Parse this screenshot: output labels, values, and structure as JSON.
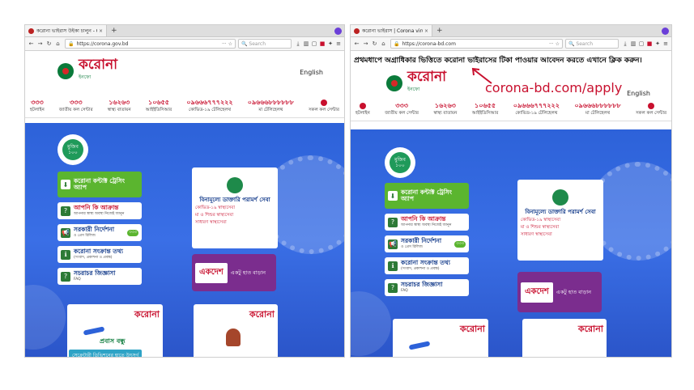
{
  "left": {
    "tab_title": "করোনা ভাইরাস উইকা চালুন - Co",
    "url": "https://corona.gov.bd",
    "search_placeholder": "Search",
    "logo_text": "করোনা",
    "logo_sub": "ইনফো",
    "english_label": "English",
    "hotlines": [
      {
        "number": "৩৩৩",
        "label": "হটলাইন"
      },
      {
        "number": "৩৩৩",
        "label": "জাতীয় কল সেন্টার"
      },
      {
        "number": "১৬২৬৩",
        "label": "স্বাস্থ্য বাতায়ন"
      },
      {
        "number": "১০৬৫৫",
        "label": "আইইডিসিআর"
      },
      {
        "number": "০৯৬৬৬৭৭৭২২২",
        "label": "কোভিড-১৯ টেলিহেলথ"
      },
      {
        "number": "০৯৬৬৬৮৮৮৮৮৮",
        "label": "মা টেলিহেলথ"
      },
      {
        "number": "",
        "label": "সকল কল সেন্টার"
      }
    ],
    "menu": [
      {
        "title": "করোনা কন্টাক্ট ট্রেসিং অ্যাপ",
        "sub": ""
      },
      {
        "title": "আপনি কি আক্রান্ত",
        "sub": "আপনার স্বাস্থ্য অবস্থা নিজেই জানুন"
      },
      {
        "title": "সরকারী নির্দেশনা",
        "sub": "ও প্রেস রিলিজ",
        "pill": "৩৩৩"
      },
      {
        "title": "করোনা সংক্রান্ত তথ্য",
        "sub": "(সংবাদ, প্রকাশনা ও প্রবন্ধ)"
      },
      {
        "title": "সচরাচর জিজ্ঞাসা",
        "sub": "FAQ"
      }
    ],
    "card": {
      "title": "বিনামূল্যে ডাক্তারি পরামর্শ সেবা",
      "items": [
        "কোভিড-১৯ স্বাস্থ্যসেবা",
        "মা ও শিশুর স্বাস্থ্যসেবা",
        "সাধারণ স্বাস্থ্যসেবা"
      ]
    },
    "ekdesh": {
      "box": "একদেশ",
      "text": "একটু হাত বাড়ান"
    },
    "promo1": {
      "logo": "করোনা",
      "text": "প্রবাস বন্ধু",
      "banner": "সেক্রেটারী ডিভিশনের হাতে উৎসর্গ"
    },
    "promo2": {
      "logo": "করোনা"
    }
  },
  "right": {
    "tab_title": "করোনা ভাইরাস | Corona virus",
    "url": "https://corona-bd.com",
    "search_placeholder": "Search",
    "notice": "প্রথমধাপে অগ্রাধিকার ভিত্তিতে করোনা ভাইরাসের টিকা পাওয়ার আবেদন করতে এখানে ক্লিক করুন।",
    "scam_url": "corona-bd.com/apply",
    "logo_text": "করোনা",
    "logo_sub": "ইনফো",
    "english_label": "English",
    "hotlines": [
      {
        "number": "",
        "label": "হটলাইন"
      },
      {
        "number": "৩৩৩",
        "label": "জাতীয় কল সেন্টার"
      },
      {
        "number": "১৬২৬৩",
        "label": "স্বাস্থ্য বাতায়ন"
      },
      {
        "number": "১০৬৫৫",
        "label": "আইইডিসিআর"
      },
      {
        "number": "০৯৬৬৬৭৭৭২২২",
        "label": "কোভিড-১৯ টেলিহেলথ"
      },
      {
        "number": "০৯৬৬৬৮৮৮৮৮৮",
        "label": "মা টেলিহেলথ"
      },
      {
        "number": "",
        "label": "সকল কল সেন্টার"
      }
    ],
    "menu": [
      {
        "title": "করোনা কন্টাক্ট ট্রেসিং অ্যাপ",
        "sub": ""
      },
      {
        "title": "আপনি কি আক্রান্ত",
        "sub": "আপনার স্বাস্থ্য অবস্থা নিজেই জানুন"
      },
      {
        "title": "সরকারী নির্দেশনা",
        "sub": "ও প্রেস রিলিজ",
        "pill": "৩৩৩"
      },
      {
        "title": "করোনা সংক্রান্ত তথ্য",
        "sub": "(সংবাদ, প্রকাশনা ও প্রবন্ধ)"
      },
      {
        "title": "সচরাচর জিজ্ঞাসা",
        "sub": "FAQ"
      }
    ],
    "card": {
      "title": "বিনামূল্যে ডাক্তারি পরামর্শ সেবা",
      "items": [
        "কোভিড-১৯ স্বাস্থ্যসেবা",
        "মা ও শিশুর স্বাস্থ্যসেবা",
        "সাধারণ স্বাস্থ্যসেবা"
      ]
    },
    "ekdesh": {
      "box": "একদেশ",
      "text": "একটু হাত বাড়ান"
    },
    "promo1": {
      "logo": "করোনা"
    },
    "promo2": {
      "logo": "করোনা"
    }
  }
}
